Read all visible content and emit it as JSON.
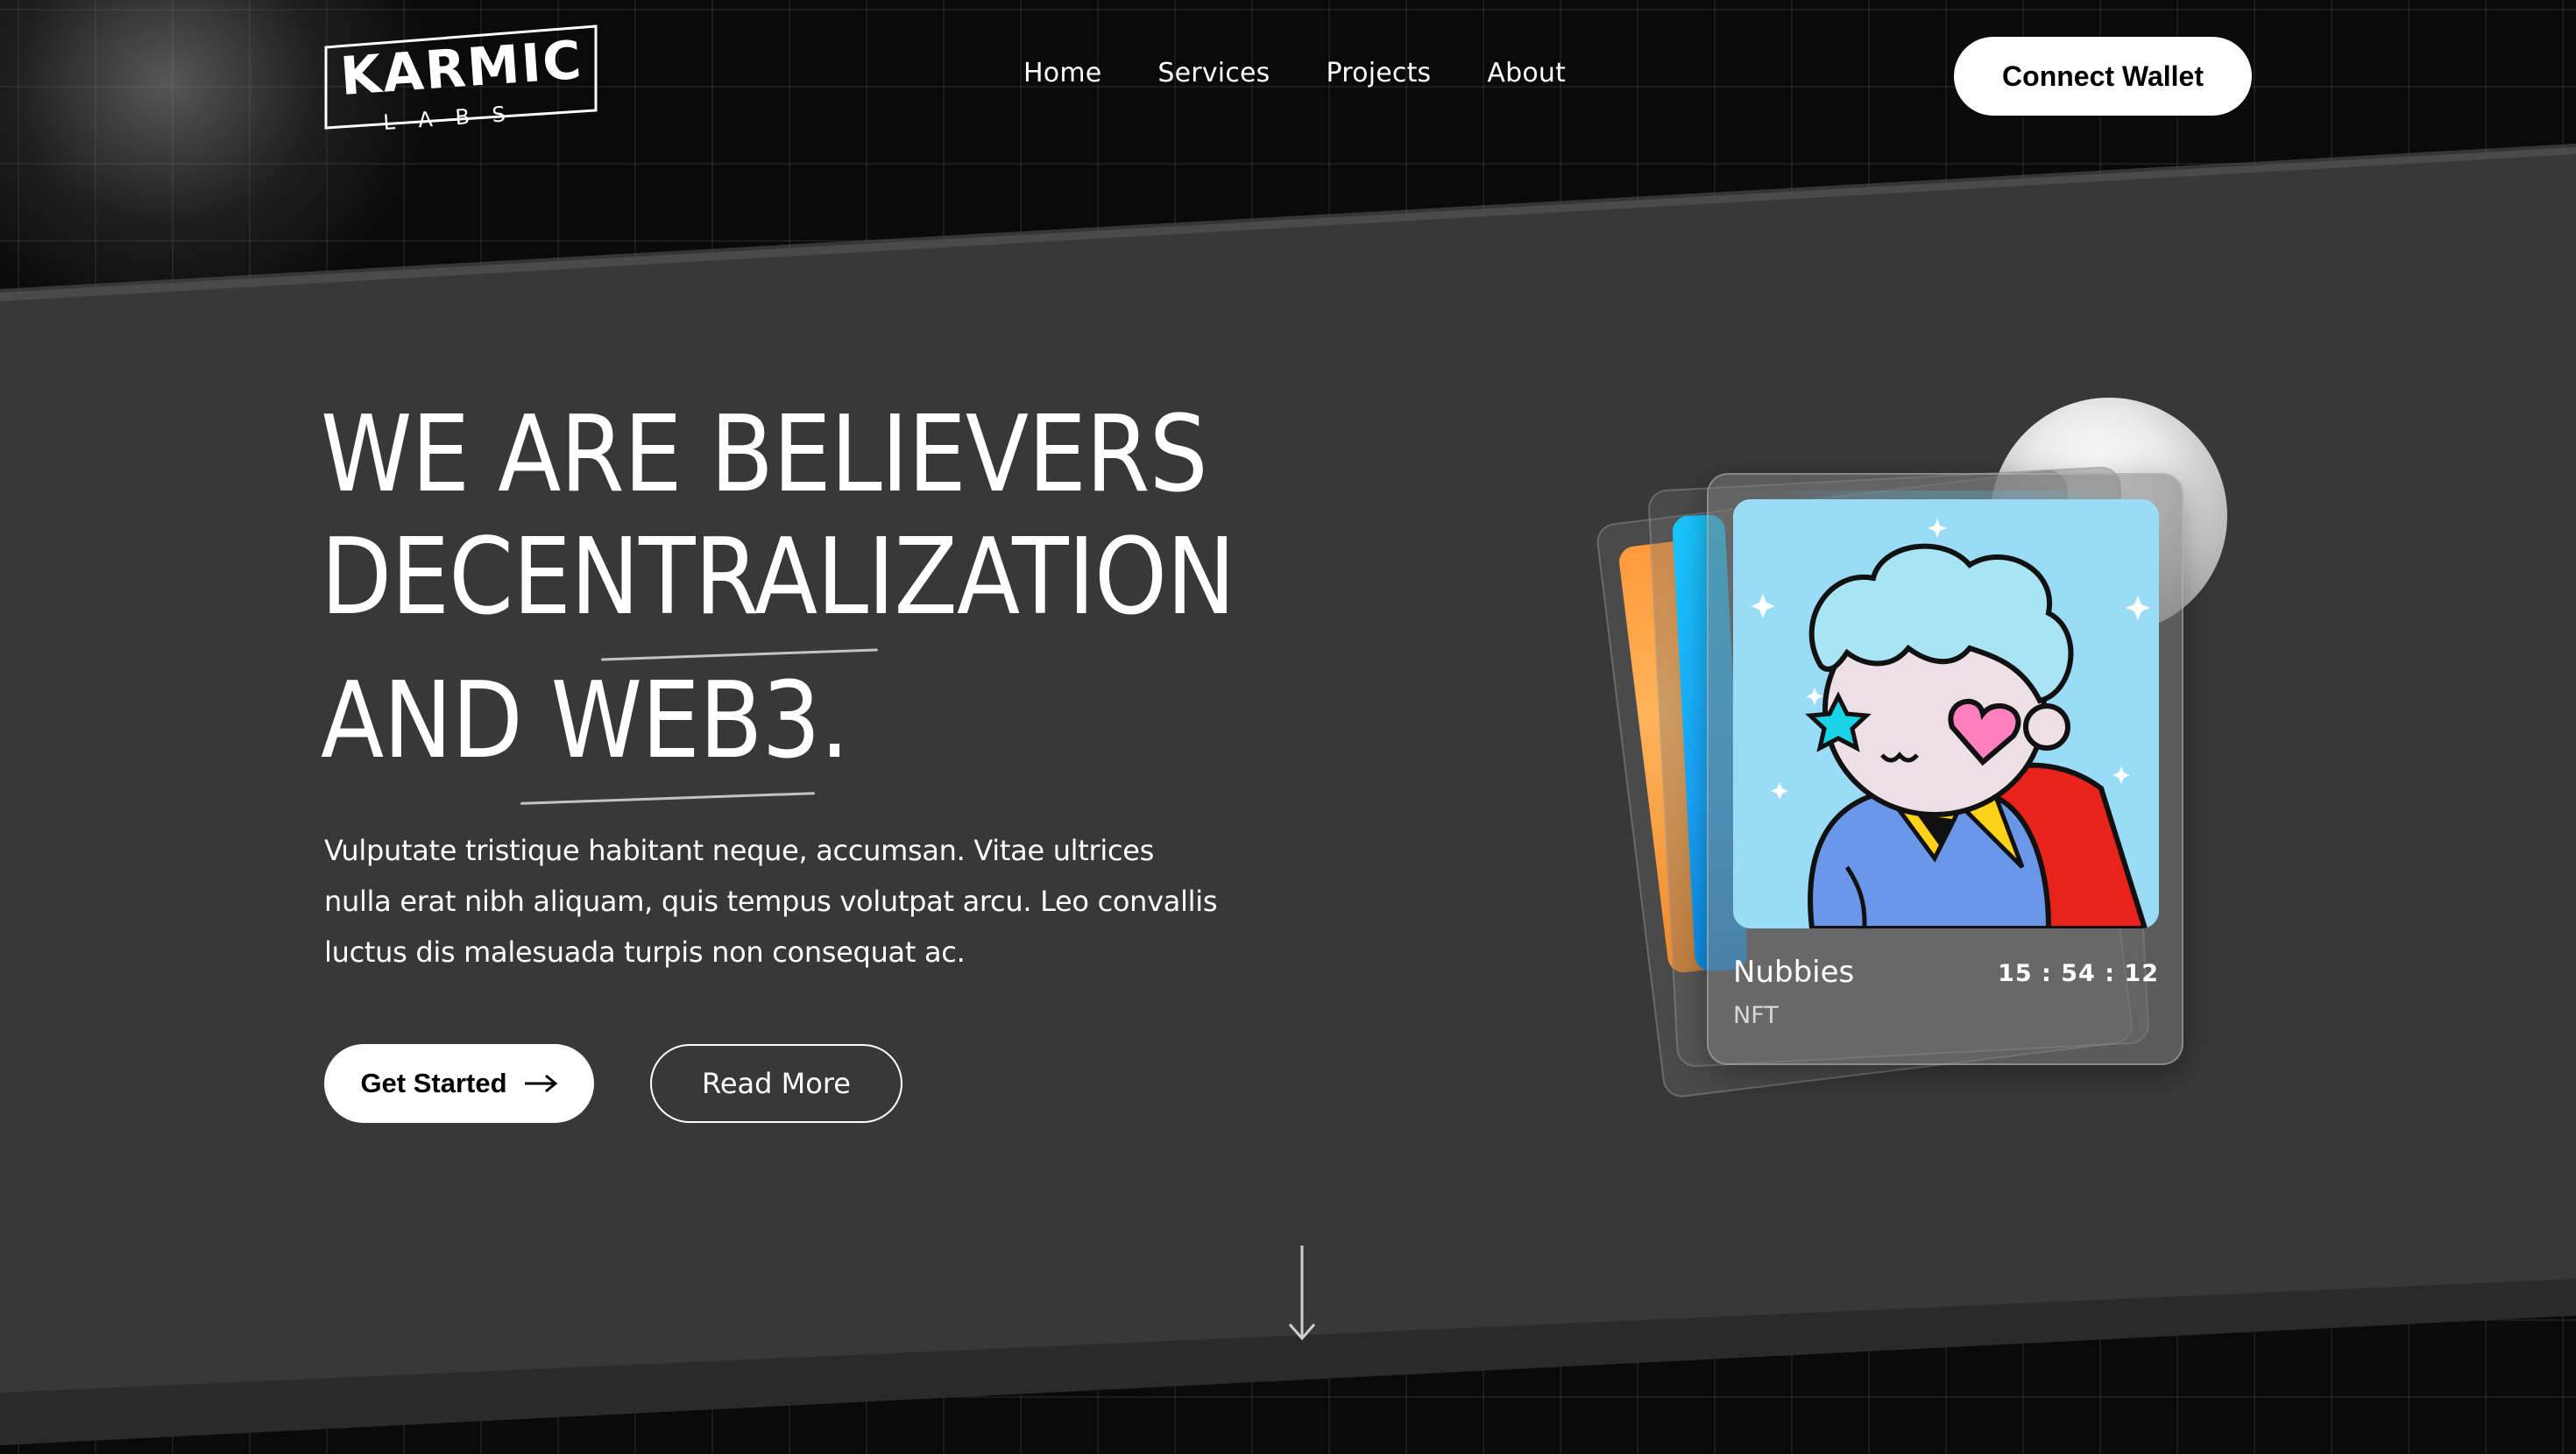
{
  "brand": {
    "name": "KARMIC",
    "sub": "LABS"
  },
  "nav": {
    "items": [
      {
        "label": "Home"
      },
      {
        "label": "Services"
      },
      {
        "label": "Projects"
      },
      {
        "label": "About"
      }
    ],
    "cta_label": "Connect Wallet"
  },
  "hero": {
    "headline_line1": "WE ARE BELIEVERS",
    "headline_line2": "DECENTRALIZATION",
    "headline_line3": "AND WEB3.",
    "description": "Vulputate tristique habitant neque, accumsan. Vitae ultrices nulla erat nibh aliquam, quis tempus volutpat arcu. Leo convallis luctus dis malesuada turpis non consequat ac.",
    "primary_button": "Get Started",
    "secondary_button": "Read More"
  },
  "nft_card": {
    "name": "Nubbies",
    "type": "NFT",
    "timer": "15 : 54 : 12"
  },
  "colors": {
    "page_bg": "#0a0a0a",
    "band_bg": "#383838",
    "button_bg": "#ffffff",
    "nft_sky": "#9adcf7",
    "accent_orange": "#ff9a3c",
    "accent_blue": "#19c8ff"
  },
  "icons": {
    "arrow_right": "arrow-right-icon",
    "arrow_down": "arrow-down-icon"
  }
}
